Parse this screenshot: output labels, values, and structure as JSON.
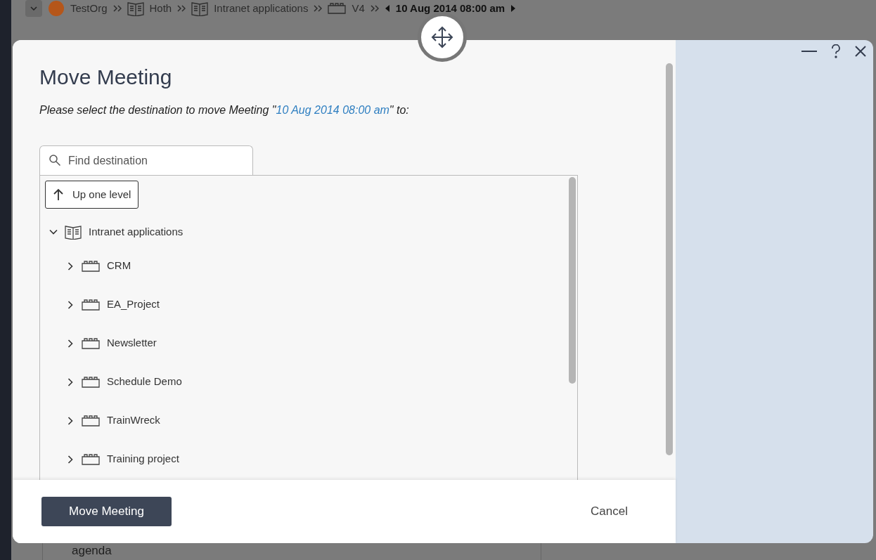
{
  "background": {
    "breadcrumb": [
      {
        "label": "TestOrg",
        "kind": "org"
      },
      {
        "label": "Hoth",
        "kind": "book"
      },
      {
        "label": "Intranet applications",
        "kind": "book"
      },
      {
        "label": "V4",
        "kind": "project"
      }
    ],
    "current": "10 Aug 2014 08:00 am",
    "agenda_label": "agenda"
  },
  "dialog": {
    "title": "Move Meeting",
    "prompt_before": "Please select the destination to move Meeting \"",
    "prompt_link": "10 Aug 2014 08:00 am",
    "prompt_after": "\" to:",
    "search": {
      "placeholder": "Find destination"
    },
    "up_button": "Up one level",
    "tree": [
      {
        "label": "Intranet applications",
        "kind": "book",
        "expanded": true,
        "children": [
          {
            "label": "CRM",
            "kind": "project",
            "expanded": false
          },
          {
            "label": "EA_Project",
            "kind": "project",
            "expanded": false
          },
          {
            "label": "Newsletter",
            "kind": "project",
            "expanded": false
          },
          {
            "label": "Schedule Demo",
            "kind": "project",
            "expanded": false
          },
          {
            "label": "TrainWreck",
            "kind": "project",
            "expanded": false
          },
          {
            "label": "Training project",
            "kind": "project",
            "expanded": false
          }
        ]
      }
    ],
    "primary_button": "Move Meeting",
    "cancel_button": "Cancel"
  }
}
